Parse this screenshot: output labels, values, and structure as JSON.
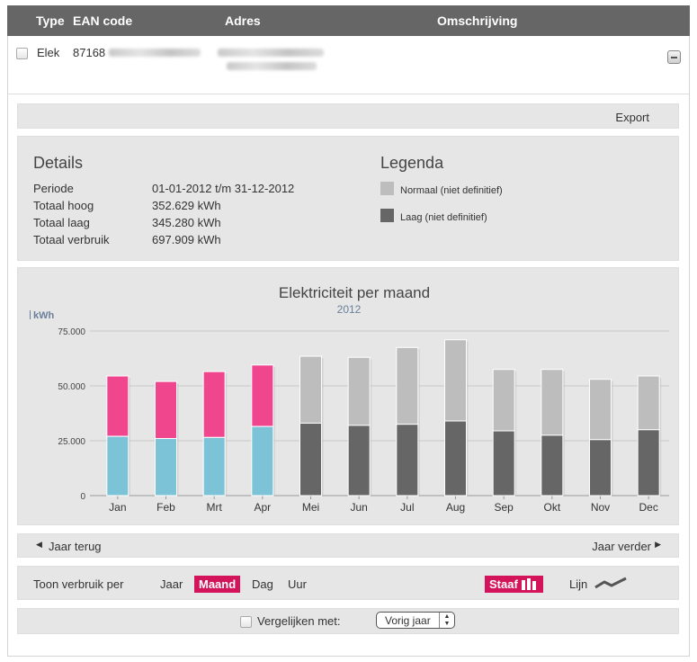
{
  "table": {
    "headers": {
      "type": "Type",
      "ean": "EAN code",
      "address": "Adres",
      "description": "Omschrijving"
    },
    "row": {
      "type": "Elek",
      "ean_visible": "87168"
    }
  },
  "toolbar": {
    "export_label": "Export"
  },
  "details": {
    "title": "Details",
    "rows": [
      {
        "label": "Periode",
        "value": "01-01-2012 t/m 31-12-2012"
      },
      {
        "label": "Totaal hoog",
        "value": "352.629 kWh"
      },
      {
        "label": "Totaal laag",
        "value": "345.280 kWh"
      },
      {
        "label": "Totaal verbruik",
        "value": "697.909 kWh"
      }
    ]
  },
  "legend": {
    "title": "Legenda",
    "items": [
      {
        "label": "Normaal (niet definitief)",
        "color": "#bdbdbd"
      },
      {
        "label": "Laag (niet definitief)",
        "color": "#666666"
      }
    ]
  },
  "colors": {
    "accent": "#d4145a",
    "definitive_high": "#f0468e",
    "definitive_low": "#7cc3d7",
    "estimated_high": "#bdbdbd",
    "estimated_low": "#666666"
  },
  "chart_data": {
    "type": "bar",
    "stacked": true,
    "title": "Elektriciteit per maand",
    "subtitle": "2012",
    "ylabel": "kWh",
    "ylim": [
      0,
      75000
    ],
    "yticks": [
      "0",
      "25.000",
      "50.000",
      "75.000"
    ],
    "categories": [
      "Jan",
      "Feb",
      "Mrt",
      "Apr",
      "Mei",
      "Jun",
      "Jul",
      "Aug",
      "Sep",
      "Okt",
      "Nov",
      "Dec"
    ],
    "series": [
      {
        "values": [
          27000,
          26000,
          26500,
          31500,
          33000,
          32000,
          32500,
          34000,
          29500,
          27500,
          25500,
          30000
        ]
      },
      {
        "values": [
          27500,
          26000,
          30000,
          28000,
          30500,
          31000,
          35000,
          37000,
          28000,
          30000,
          27500,
          24500
        ]
      }
    ],
    "definitive_months": 4,
    "grid": true,
    "legend": "none"
  },
  "navigation": {
    "prev_year": "Jaar terug",
    "next_year": "Jaar verder"
  },
  "view": {
    "label": "Toon verbruik per",
    "options": [
      "Jaar",
      "Maand",
      "Dag",
      "Uur"
    ],
    "selected": "Maand",
    "bar_label": "Staaf",
    "line_label": "Lijn"
  },
  "compare": {
    "label": "Vergelijken met:",
    "selected": "Vorig jaar"
  }
}
